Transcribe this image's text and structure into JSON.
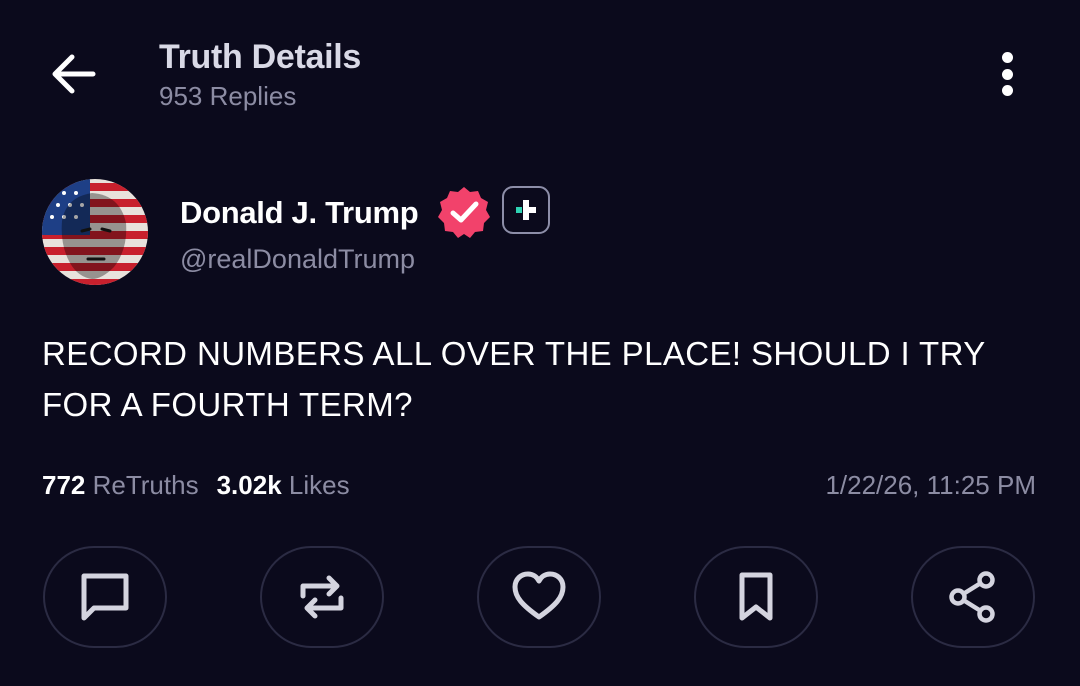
{
  "header": {
    "title": "Truth Details",
    "replies": "953 Replies",
    "icons": {
      "back": "arrow-left-icon",
      "more": "more-vertical-icon"
    }
  },
  "author": {
    "name": "Donald J. Trump",
    "handle": "@realDonaldTrump",
    "verified_color": "#f2426b",
    "plus_color": "#2fd3b4"
  },
  "post": {
    "text": "RECORD NUMBERS ALL OVER THE PLACE! SHOULD I TRY FOR A FOURTH TERM?",
    "retruths_count": "772",
    "retruths_label": "ReTruths",
    "likes_count": "3.02k",
    "likes_label": "Likes",
    "timestamp": "1/22/26, 11:25 PM"
  },
  "actions": [
    {
      "name": "reply",
      "icon": "comment-icon"
    },
    {
      "name": "retruth",
      "icon": "repost-icon"
    },
    {
      "name": "like",
      "icon": "heart-icon"
    },
    {
      "name": "bookmark",
      "icon": "bookmark-icon"
    },
    {
      "name": "share",
      "icon": "share-icon"
    }
  ],
  "colors": {
    "background": "#0b0a1c",
    "muted_text": "#8c8ca3",
    "button_border": "#2b2b43"
  }
}
